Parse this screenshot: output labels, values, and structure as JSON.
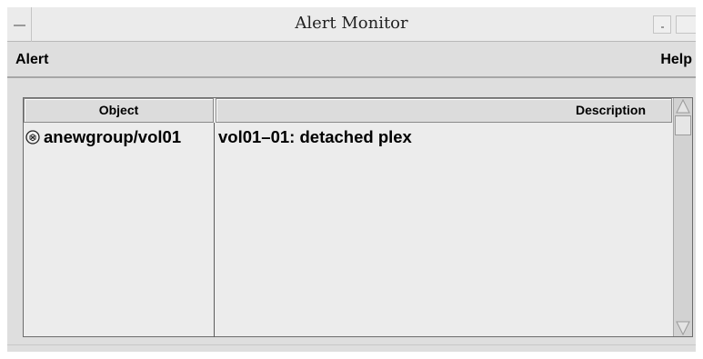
{
  "window": {
    "title": "Alert Monitor"
  },
  "menubar": {
    "alert_label": "Alert",
    "help_label": "Help"
  },
  "table": {
    "columns": [
      "Object",
      "Description"
    ],
    "rows": [
      {
        "object": "anewgroup/vol01",
        "description": "vol01–01: detached plex",
        "icon": "alert-x-icon"
      }
    ]
  },
  "colors": {
    "window_bg": "#dedede",
    "title_bg": "#ebebeb",
    "list_bg": "#ececec",
    "border": "#6c6c6c"
  }
}
